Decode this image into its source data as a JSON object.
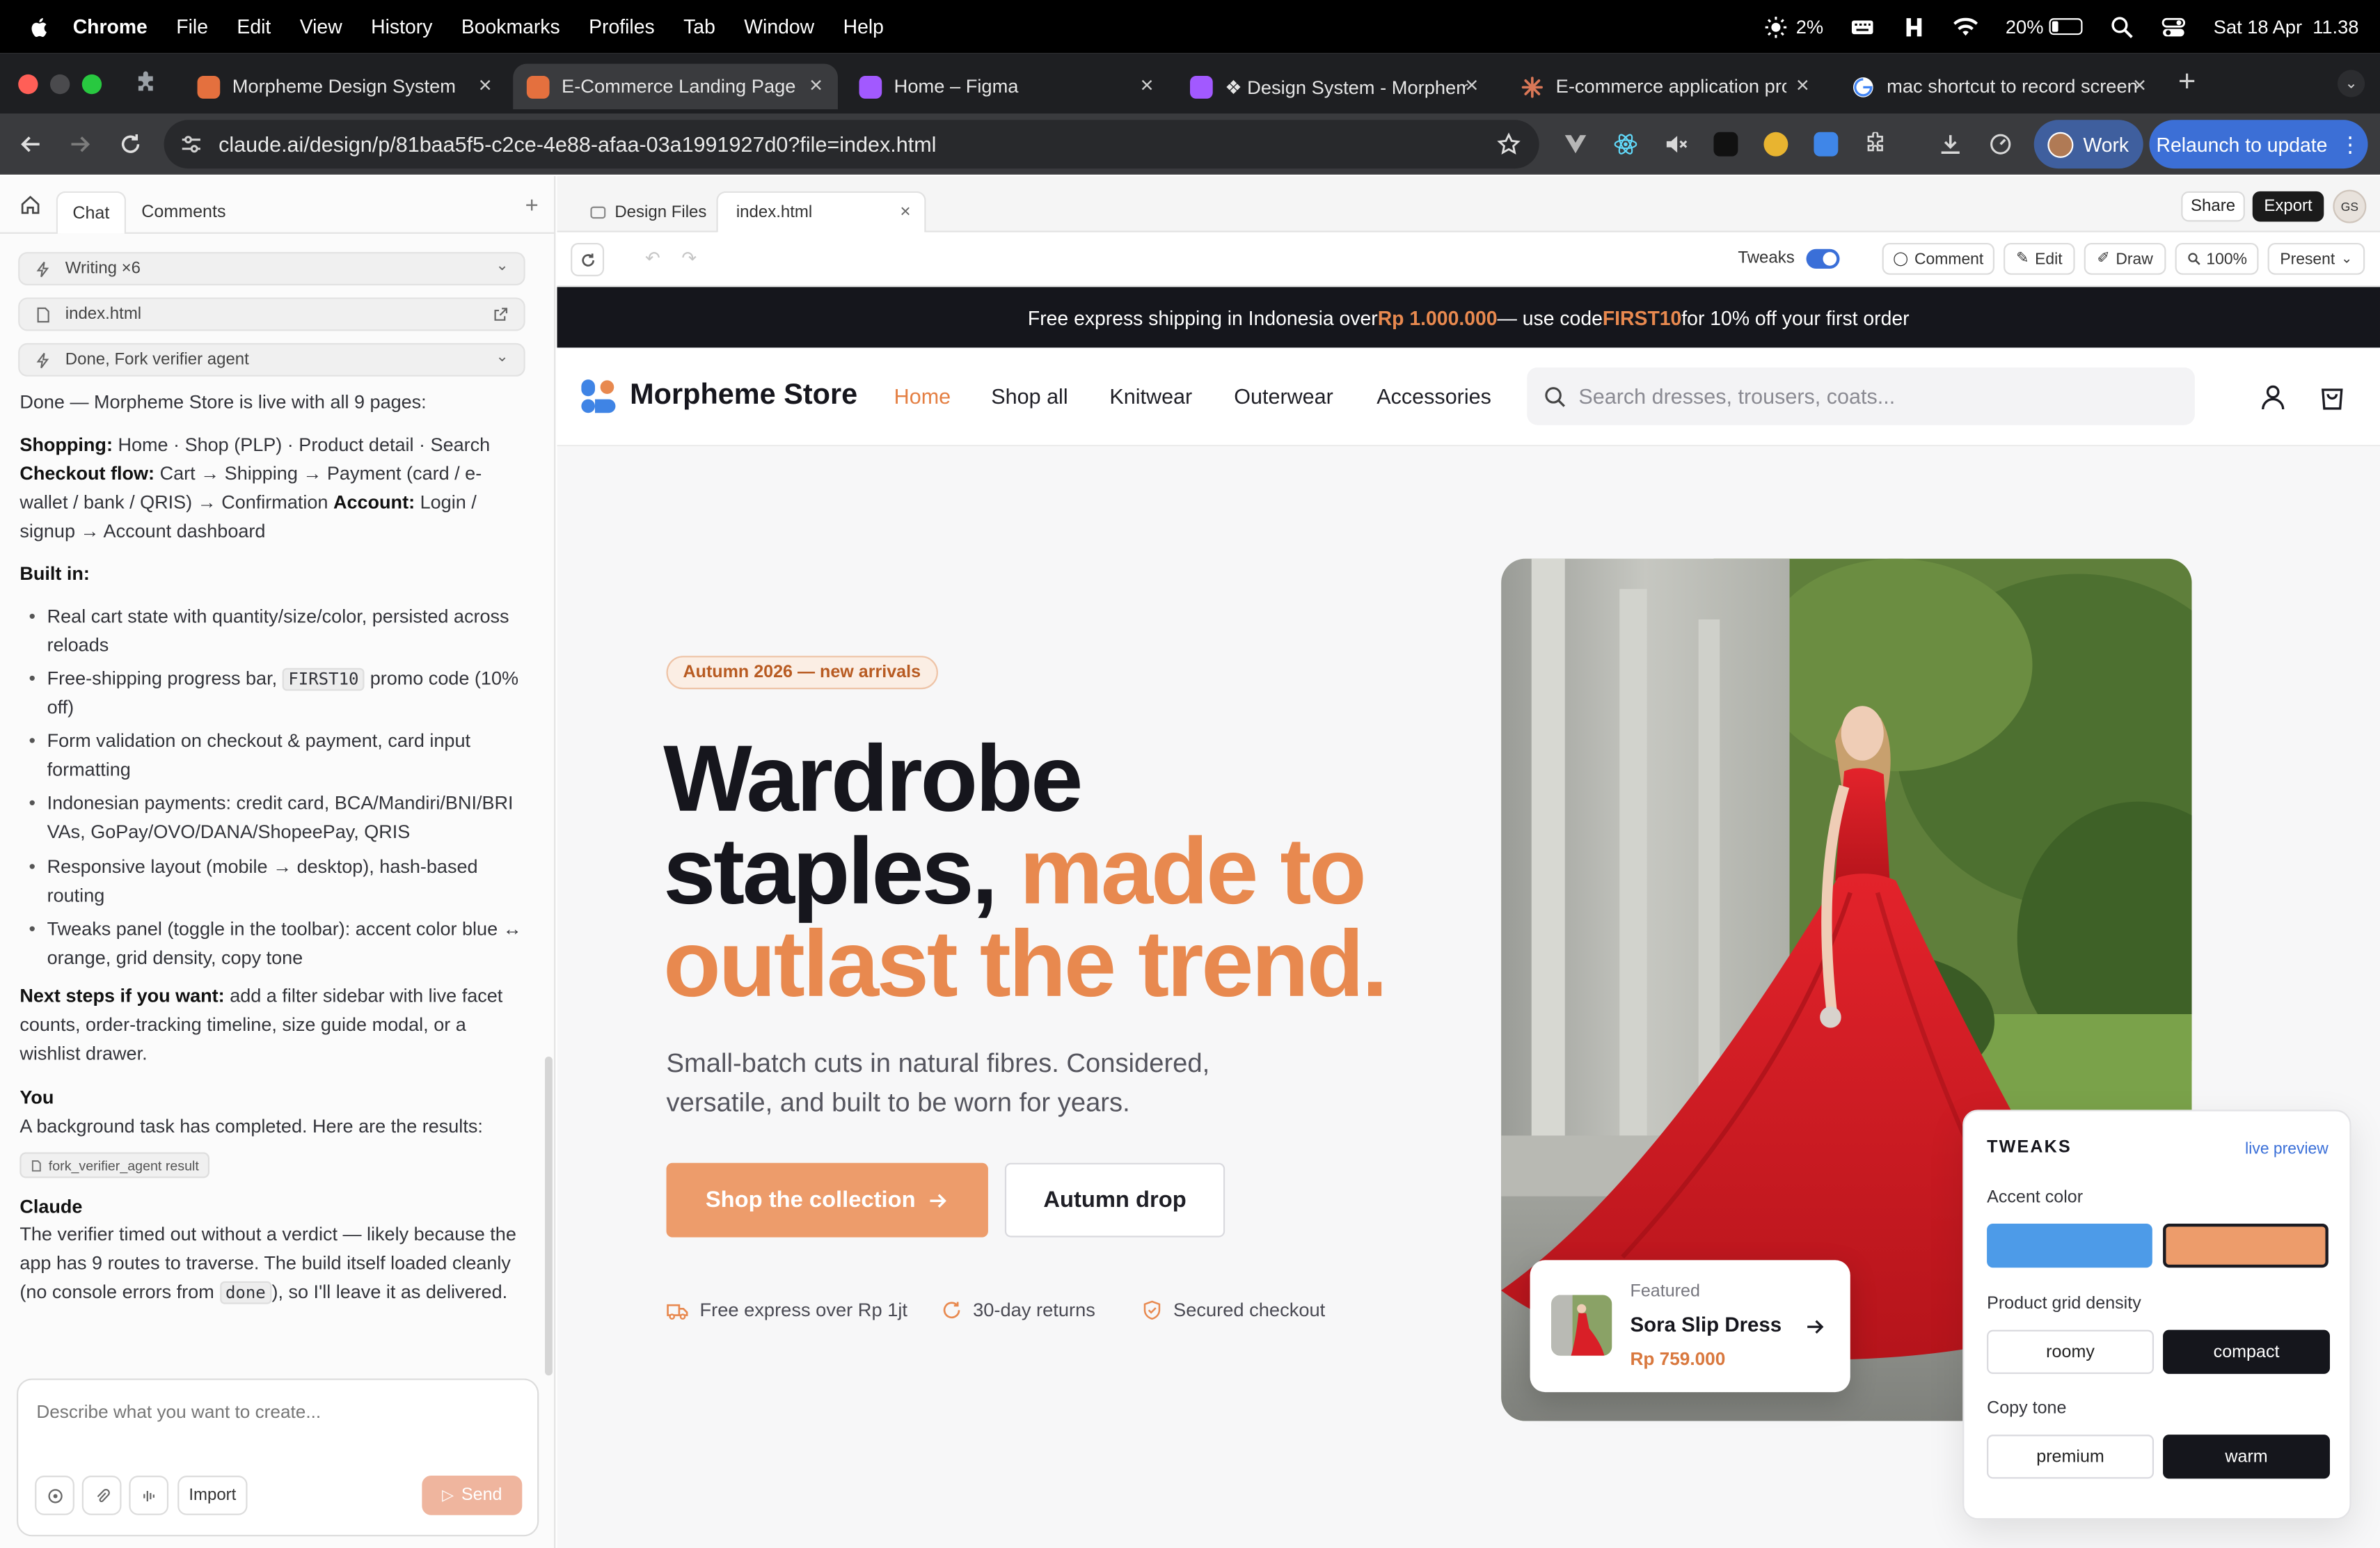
{
  "menubar": {
    "app": "Chrome",
    "menus": [
      "File",
      "Edit",
      "View",
      "History",
      "Bookmarks",
      "Profiles",
      "Tab",
      "Window",
      "Help"
    ],
    "cpu": "2%",
    "battery": "20%",
    "datetime": "Sat 18 Apr  11.38"
  },
  "tabs": [
    {
      "label": "Morpheme Design System",
      "color": "#e4703e"
    },
    {
      "label": "E-Commerce Landing Page",
      "color": "#e4703e"
    },
    {
      "label": "Home – Figma",
      "color": "#a259ff"
    },
    {
      "label": "❖ Design System - Morpheme",
      "color": "#a259ff"
    },
    {
      "label": "E-commerce application prompt",
      "color": "#d97757"
    },
    {
      "label": "mac shortcut to record screen",
      "color": "#4285f4"
    }
  ],
  "address": {
    "url": "claude.ai/design/p/81baa5f5-c2ce-4e88-afaa-03a1991927d0?file=index.html",
    "work_label": "Work",
    "relaunch_label": "Relaunch to update"
  },
  "chat": {
    "tab_chat": "Chat",
    "tab_comments": "Comments",
    "tool_writing": "Writing ×6",
    "tool_file": "index.html",
    "tool_done": "Done, Fork verifier agent",
    "intro": "Done — Morpheme Store is live with all 9 pages:",
    "shopping_label": "Shopping:",
    "shopping_text": " Home · Shop (PLP) · Product detail · Search",
    "checkout_label": "Checkout flow:",
    "checkout_text": " Cart → Shipping → Payment (card / e-wallet / bank / QRIS) → Confirmation ",
    "account_label": "Account:",
    "account_text": " Login / signup → Account dashboard",
    "built_label": "Built in:",
    "bullet1": "Real cart state with quantity/size/color, persisted across reloads",
    "bullet2_pre": "Free-shipping progress bar, ",
    "bullet2_code": "FIRST10",
    "bullet2_post": " promo code (10% off)",
    "bullet3": "Form validation on checkout & payment, card input formatting",
    "bullet4": "Indonesian payments: credit card, BCA/Mandiri/BNI/BRI VAs, GoPay/OVO/DANA/ShopeePay, QRIS",
    "bullet5": "Responsive layout (mobile → desktop), hash-based routing",
    "bullet6": "Tweaks panel (toggle in the toolbar): accent color blue ↔ orange, grid density, copy tone",
    "next_label": "Next steps if you want:",
    "next_text": " add a filter sidebar with live facet counts, order-tracking timeline, size guide modal, or a wishlist drawer.",
    "you_label": "You",
    "you_text": "A background task has completed. Here are the results:",
    "result_chip": "fork_verifier_agent result",
    "claude_label": "Claude",
    "claude_pre": "The verifier timed out without a verdict — likely because the app has 9 routes to traverse. The build itself loaded cleanly (no console errors from ",
    "claude_code": "done",
    "claude_post": "), so I'll leave it as delivered.",
    "composer_placeholder": "Describe what you want to create...",
    "import_label": "Import",
    "send_label": "Send"
  },
  "design": {
    "tab_files": "Design Files",
    "tab_index": "index.html",
    "share": "Share",
    "export": "Export",
    "avatar": "GS",
    "tweaks_label": "Tweaks",
    "comment": "Comment",
    "edit": "Edit",
    "draw": "Draw",
    "zoom": "100%",
    "present": "Present"
  },
  "store": {
    "promo_pre": "Free express shipping in Indonesia over ",
    "promo_amount": "Rp 1.000.000",
    "promo_mid": " — use code ",
    "promo_code": "FIRST10",
    "promo_post": " for 10% off your first order",
    "brand": "Morpheme Store",
    "nav": [
      "Home",
      "Shop all",
      "Knitwear",
      "Outerwear",
      "Accessories"
    ],
    "search_placeholder": "Search dresses, trousers, coats...",
    "eyebrow": "Autumn 2026 — new arrivals",
    "title_line1": "Wardrobe",
    "title_line2a": "staples, ",
    "title_line2b": "made to",
    "title_line3": "outlast the trend.",
    "subtitle": "Small-batch cuts in natural fibres. Considered, versatile, and built to be worn for years.",
    "cta_primary": "Shop the collection",
    "cta_secondary": "Autumn drop",
    "trust": [
      "Free express over Rp 1jt",
      "30-day returns",
      "Secured checkout"
    ],
    "featured_kicker": "Featured",
    "featured_name": "Sora Slip Dress",
    "featured_price": "Rp 759.000",
    "accent_color": "#e8894f"
  },
  "tweaks": {
    "title": "TWEAKS",
    "live": "live preview",
    "accent_label": "Accent color",
    "accent_blue": "#4d9be8",
    "accent_orange": "#ed9c6b",
    "density_label": "Product grid density",
    "density_options": [
      "roomy",
      "compact"
    ],
    "density_selected": "compact",
    "tone_label": "Copy tone",
    "tone_options": [
      "premium",
      "warm"
    ],
    "tone_selected": "warm"
  }
}
